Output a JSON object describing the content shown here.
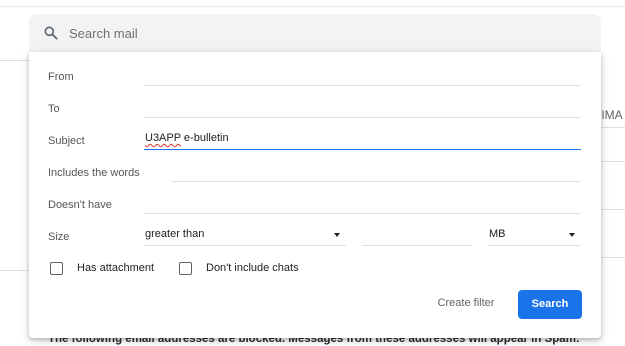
{
  "search": {
    "placeholder": "Search mail",
    "icon": "search-icon"
  },
  "background": {
    "tab_fragment": "/IMA",
    "blocked_notice": "The following email addresses are blocked. Messages from these addresses will appear in Spam:"
  },
  "filter": {
    "from": {
      "label": "From",
      "value": ""
    },
    "to": {
      "label": "To",
      "value": ""
    },
    "subject": {
      "label": "Subject",
      "value_misspelled": "U3APP",
      "value_rest": " e-bulletin"
    },
    "has_words": {
      "label": "Includes the words",
      "value": ""
    },
    "doesnt_have": {
      "label": "Doesn't have",
      "value": ""
    },
    "size": {
      "label": "Size",
      "operator": "greater than",
      "value": "",
      "unit": "MB"
    },
    "has_attachment": {
      "label": "Has attachment",
      "checked": false
    },
    "dont_include_chats": {
      "label": "Don't include chats",
      "checked": false
    },
    "create_filter_label": "Create filter",
    "search_button_label": "Search"
  },
  "colors": {
    "accent": "#1a73e8",
    "search_bar_bg": "#f1f3f4",
    "spellcheck": "#d93025"
  }
}
